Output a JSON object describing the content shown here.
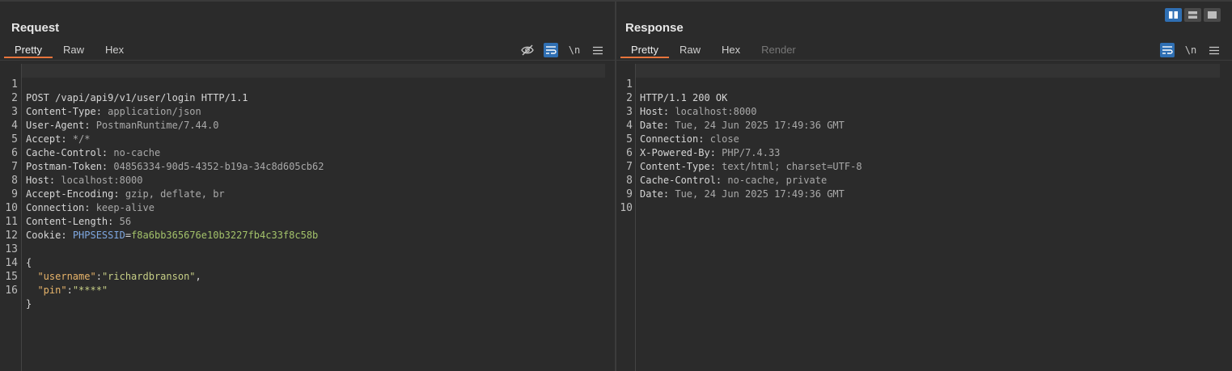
{
  "request": {
    "title": "Request",
    "tabs": [
      "Pretty",
      "Raw",
      "Hex"
    ],
    "active_tab": "Pretty",
    "toolbar": {
      "newline_label": "\\n"
    },
    "lines": [
      {
        "n": "1",
        "k": "POST /vapi/api9/v1/user/login HTTP/1.1",
        "v": ""
      },
      {
        "n": "2",
        "k": "Content-Type:",
        "v": " application/json"
      },
      {
        "n": "3",
        "k": "User-Agent:",
        "v": " PostmanRuntime/7.44.0"
      },
      {
        "n": "4",
        "k": "Accept:",
        "v": " */*"
      },
      {
        "n": "5",
        "k": "Cache-Control:",
        "v": " no-cache"
      },
      {
        "n": "6",
        "k": "Postman-Token:",
        "v": " 04856334-90d5-4352-b19a-34c8d605cb62"
      },
      {
        "n": "7",
        "k": "Host:",
        "v": " localhost:8000"
      },
      {
        "n": "8",
        "k": "Accept-Encoding:",
        "v": " gzip, deflate, br"
      },
      {
        "n": "9",
        "k": "Connection:",
        "v": " keep-alive"
      },
      {
        "n": "10",
        "k": "Content-Length:",
        "v": " 56"
      },
      {
        "n": "11",
        "k": "Cookie:",
        "v": ""
      },
      {
        "n": "12",
        "k": "",
        "v": ""
      },
      {
        "n": "13",
        "k": "{",
        "v": ""
      },
      {
        "n": "14",
        "k": "",
        "v": ""
      },
      {
        "n": "15",
        "k": "",
        "v": ""
      },
      {
        "n": "16",
        "k": "}",
        "v": ""
      }
    ],
    "cookie": {
      "name": "PHPSESSID",
      "eq": "=",
      "value": "f8a6bb365676e10b3227fb4c33f8c58b"
    },
    "json": {
      "username_key": "\"username\"",
      "username_sep": ":",
      "username_val": "\"richardbranson\"",
      "username_tail": ",",
      "pin_key": "\"pin\"",
      "pin_sep": ":",
      "pin_val": "\"****\""
    }
  },
  "response": {
    "title": "Response",
    "tabs": [
      "Pretty",
      "Raw",
      "Hex",
      "Render"
    ],
    "active_tab": "Pretty",
    "toolbar": {
      "newline_label": "\\n"
    },
    "lines": [
      {
        "n": "1",
        "k": "HTTP/1.1 200 OK",
        "v": ""
      },
      {
        "n": "2",
        "k": "Host:",
        "v": " localhost:8000"
      },
      {
        "n": "3",
        "k": "Date:",
        "v": " Tue, 24 Jun 2025 17:49:36 GMT"
      },
      {
        "n": "4",
        "k": "Connection:",
        "v": " close"
      },
      {
        "n": "5",
        "k": "X-Powered-By:",
        "v": " PHP/7.4.33"
      },
      {
        "n": "6",
        "k": "Content-Type:",
        "v": " text/html; charset=UTF-8"
      },
      {
        "n": "7",
        "k": "Cache-Control:",
        "v": " no-cache, private"
      },
      {
        "n": "8",
        "k": "Date:",
        "v": " Tue, 24 Jun 2025 17:49:36 GMT"
      },
      {
        "n": "9",
        "k": "",
        "v": ""
      },
      {
        "n": "10",
        "k": "",
        "v": ""
      }
    ]
  },
  "colors": {
    "accent_tab": "#e8743b",
    "toggle_on": "#2f6fb3",
    "background": "#2b2b2b"
  },
  "icons": [
    "hide-icon",
    "wrap-lines-icon",
    "menu-icon",
    "split-horizontal-icon",
    "split-vertical-icon",
    "single-pane-icon"
  ]
}
